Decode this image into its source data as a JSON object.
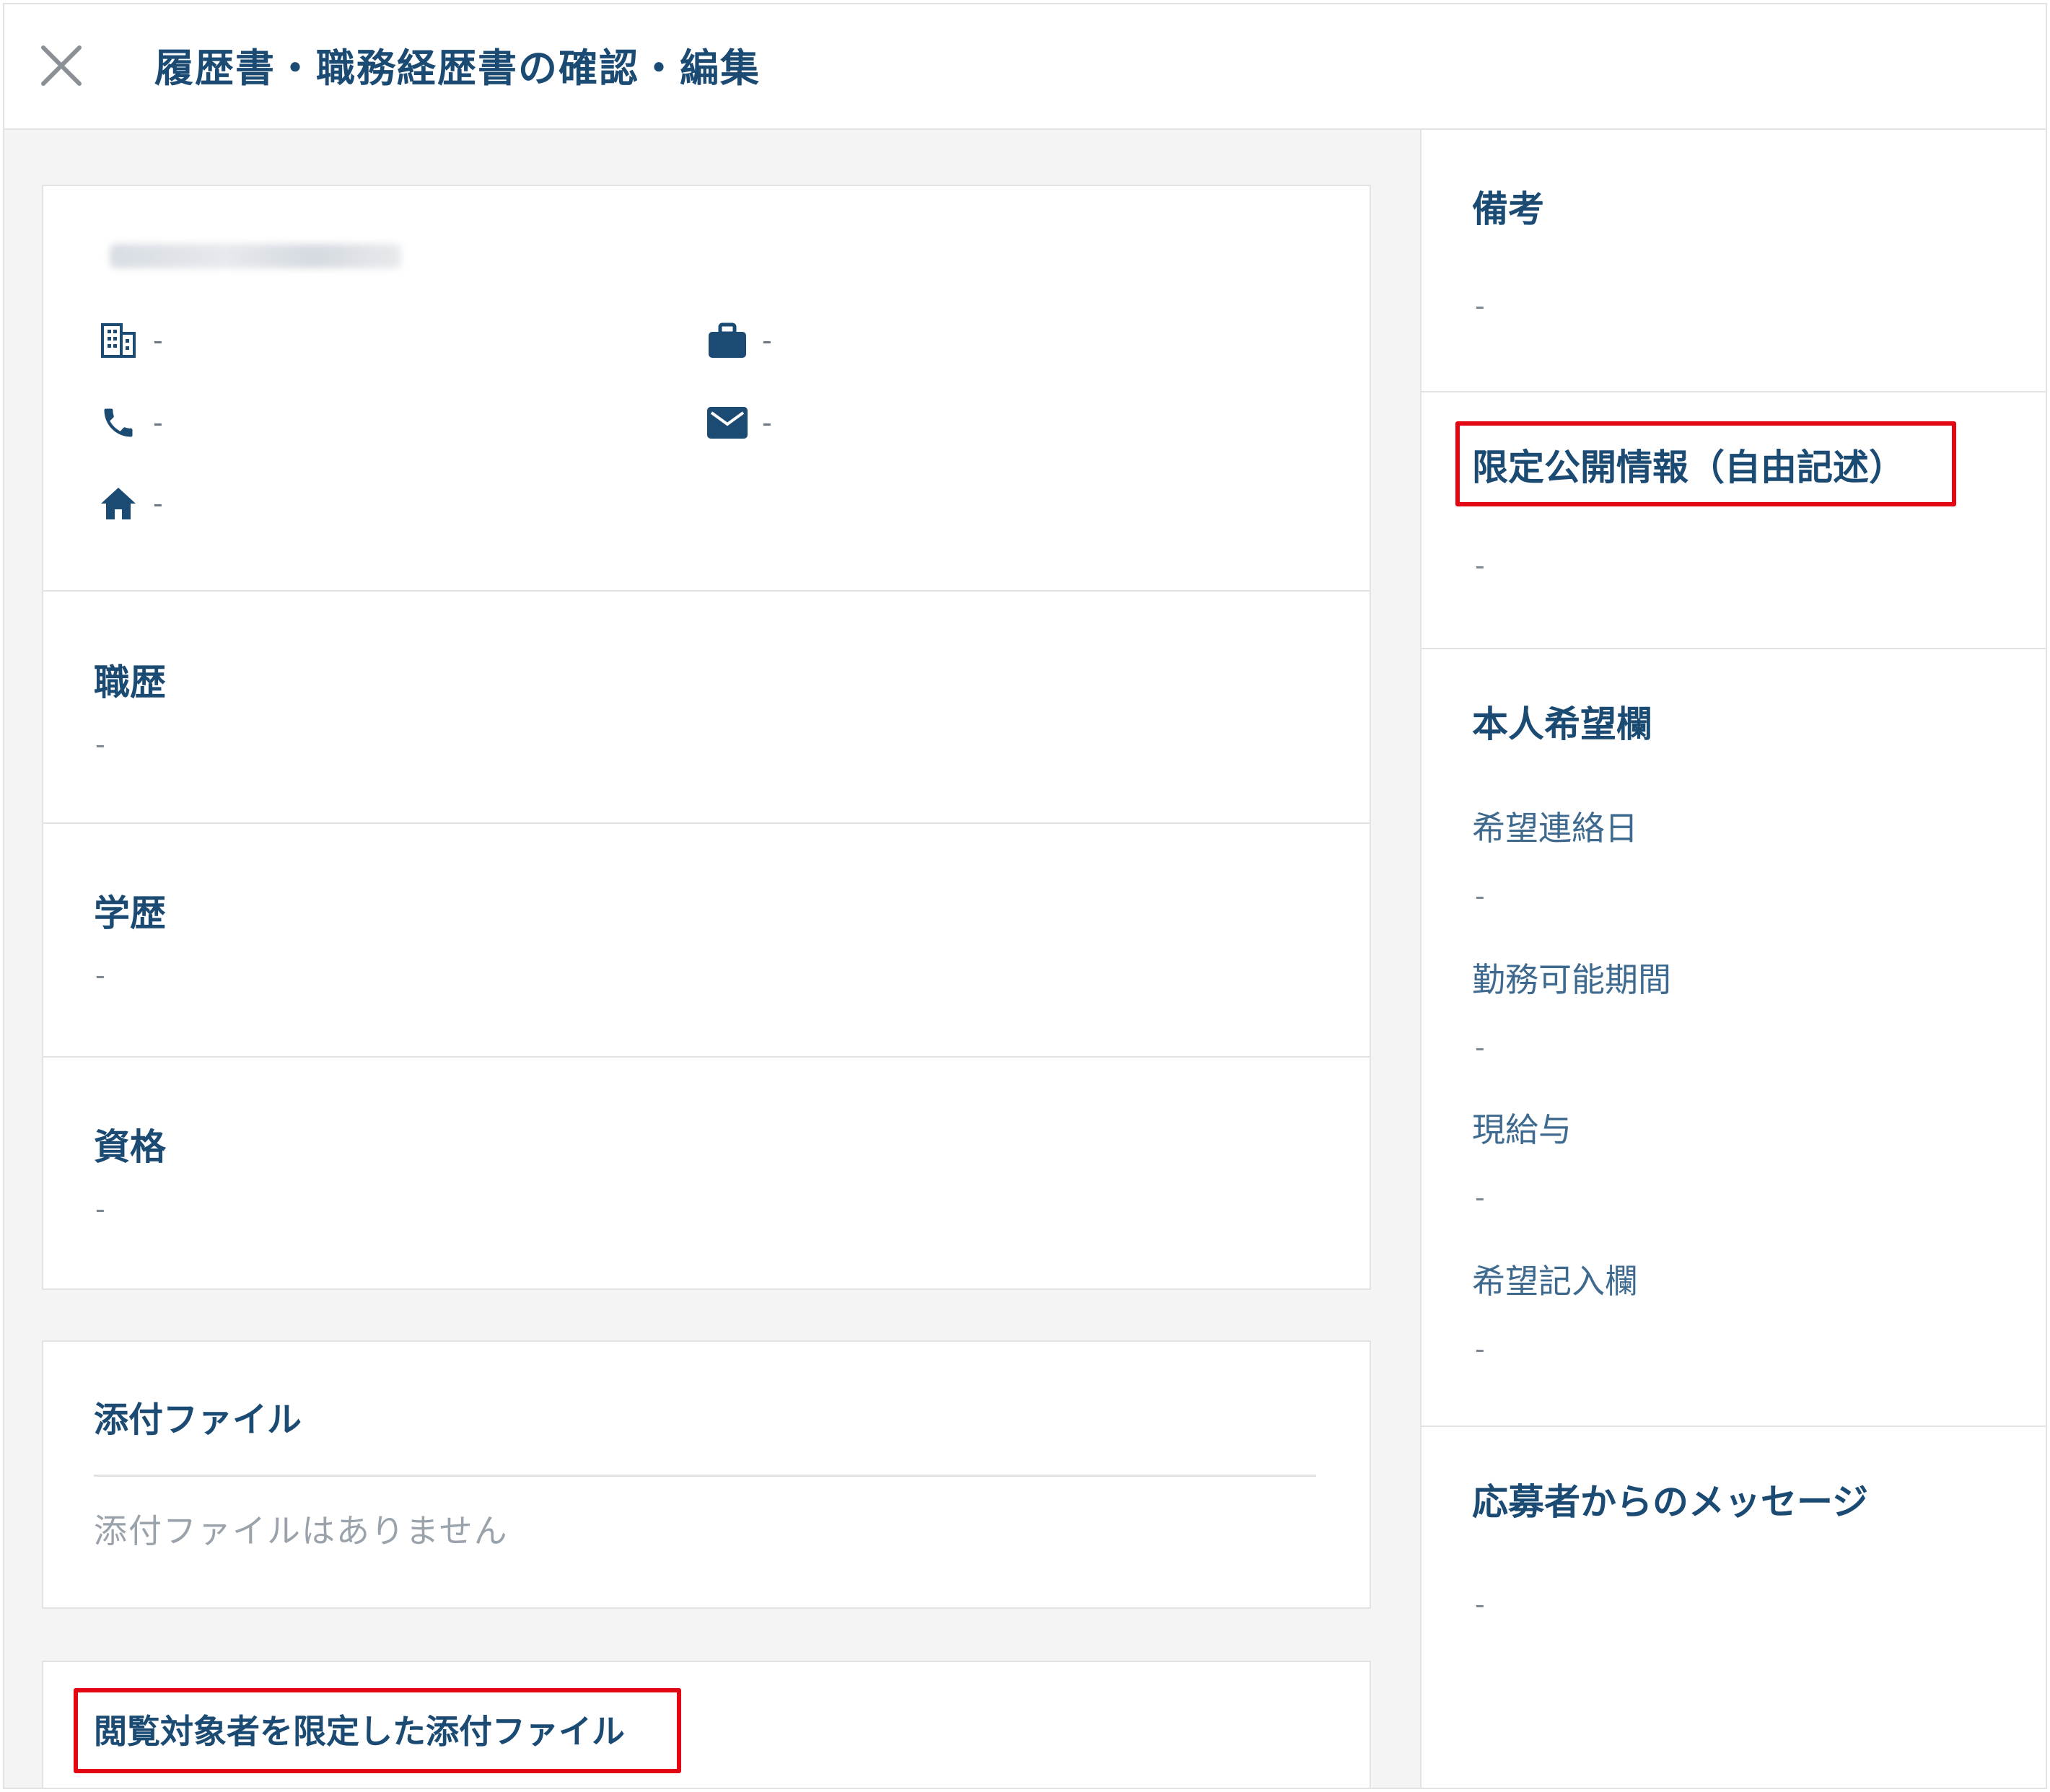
{
  "header": {
    "title": "履歴書・職務経歴書の確認・編集"
  },
  "profile": {
    "company_value": "-",
    "job_value": "-",
    "phone_value": "-",
    "email_value": "-",
    "address_value": "-"
  },
  "sections": {
    "work_history": {
      "title": "職歴",
      "value": "-"
    },
    "education": {
      "title": "学歴",
      "value": "-"
    },
    "qualifications": {
      "title": "資格",
      "value": "-"
    }
  },
  "attachments": {
    "title": "添付ファイル",
    "empty_message": "添付ファイルはありません"
  },
  "restricted_attachments": {
    "title": "閲覧対象者を限定した添付ファイル"
  },
  "right": {
    "remarks": {
      "title": "備考",
      "value": "-"
    },
    "limited_info": {
      "title": "限定公開情報（自由記述）",
      "value": "-"
    },
    "preferences": {
      "title": "本人希望欄",
      "items": [
        {
          "label": "希望連絡日",
          "value": "-"
        },
        {
          "label": "勤務可能期間",
          "value": "-"
        },
        {
          "label": "現給与",
          "value": "-"
        },
        {
          "label": "希望記入欄",
          "value": "-"
        }
      ]
    },
    "message": {
      "title": "応募者からのメッセージ",
      "value": "-"
    }
  },
  "colors": {
    "title": "#1b4a73",
    "icon": "#1b4a73",
    "highlight": "#e30613",
    "pane_bg": "#f4f4f4",
    "border": "#e3e3e3"
  },
  "icons": [
    "close-icon",
    "building-icon",
    "briefcase-icon",
    "phone-icon",
    "envelope-icon",
    "home-icon"
  ]
}
